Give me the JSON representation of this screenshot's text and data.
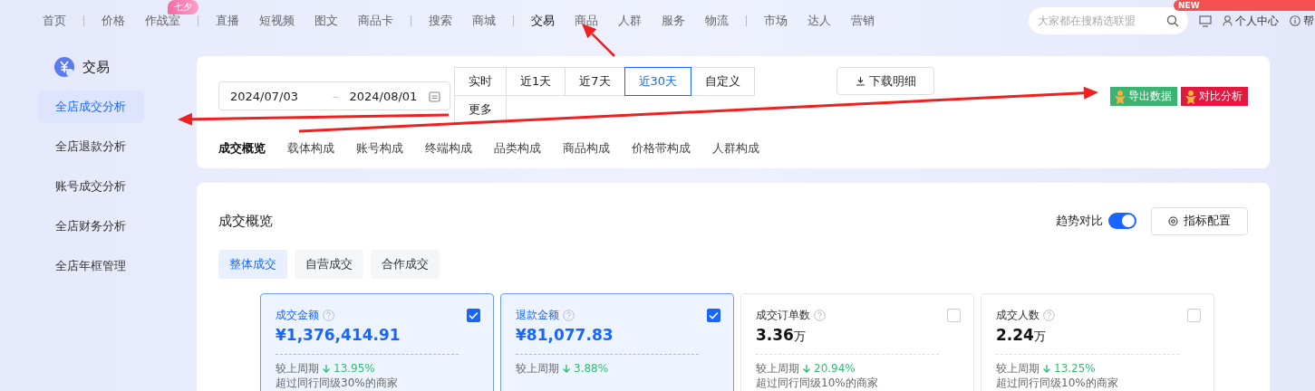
{
  "nav": {
    "groups": [
      {
        "items": [
          {
            "label": "首页",
            "selected": false
          }
        ]
      },
      {
        "items": [
          {
            "label": "价格",
            "selected": false
          },
          {
            "label": "作战室",
            "selected": false,
            "badge": "七夕"
          }
        ]
      },
      {
        "items": [
          {
            "label": "直播",
            "selected": false
          },
          {
            "label": "短视频",
            "selected": false
          },
          {
            "label": "图文",
            "selected": false
          },
          {
            "label": "商品卡",
            "selected": false
          }
        ]
      },
      {
        "items": [
          {
            "label": "搜索",
            "selected": false
          },
          {
            "label": "商城",
            "selected": false
          }
        ]
      },
      {
        "items": [
          {
            "label": "交易",
            "selected": true
          },
          {
            "label": "商品",
            "selected": false
          },
          {
            "label": "人群",
            "selected": false
          },
          {
            "label": "服务",
            "selected": false
          },
          {
            "label": "物流",
            "selected": false
          }
        ]
      },
      {
        "items": [
          {
            "label": "市场",
            "selected": false
          },
          {
            "label": "达人",
            "selected": false
          },
          {
            "label": "营销",
            "selected": false
          }
        ]
      }
    ],
    "search": {
      "placeholder": "大家都在搜精选联盟"
    },
    "new_badge": "NEW",
    "user_label": "个人中心",
    "help_label": "帮"
  },
  "sidebar": {
    "title": "交易",
    "items": [
      {
        "label": "全店成交分析",
        "selected": true
      },
      {
        "label": "全店退款分析",
        "selected": false
      },
      {
        "label": "账号成交分析",
        "selected": false
      },
      {
        "label": "全店财务分析",
        "selected": false
      },
      {
        "label": "全店年框管理",
        "selected": false
      }
    ]
  },
  "filters": {
    "date_start": "2024/07/03",
    "date_separator": "–",
    "date_end": "2024/08/01",
    "ranges": [
      {
        "label": "实时",
        "selected": false
      },
      {
        "label": "近1天",
        "selected": false
      },
      {
        "label": "近7天",
        "selected": false
      },
      {
        "label": "近30天",
        "selected": true
      },
      {
        "label": "自定义",
        "selected": false
      },
      {
        "label": "更多",
        "selected": false
      }
    ],
    "download": "下载明细",
    "export": "导出数据",
    "compare": "对比分析",
    "tabs": [
      {
        "label": "成交概览",
        "selected": true
      },
      {
        "label": "载体构成",
        "selected": false
      },
      {
        "label": "账号构成",
        "selected": false
      },
      {
        "label": "终端构成",
        "selected": false
      },
      {
        "label": "品类构成",
        "selected": false
      },
      {
        "label": "商品构成",
        "selected": false
      },
      {
        "label": "价格带构成",
        "selected": false
      },
      {
        "label": "人群构成",
        "selected": false
      }
    ]
  },
  "overview": {
    "title": "成交概览",
    "trend_label": "趋势对比",
    "trend_on": true,
    "config_button": "指标配置",
    "scopes": [
      {
        "label": "整体成交",
        "selected": true
      },
      {
        "label": "自营成交",
        "selected": false
      },
      {
        "label": "合作成交",
        "selected": false
      }
    ],
    "metrics": [
      {
        "title": "成交金额",
        "value": "¥1,376,414.91",
        "selected": true,
        "compare_label": "较上周期",
        "change": "13.95%",
        "benchmark": "超过同行同级30%的商家"
      },
      {
        "title": "退款金额",
        "value": "¥81,077.83",
        "selected": true,
        "compare_label": "较上周期",
        "change": "3.88%"
      },
      {
        "title": "成交订单数",
        "value": "3.36",
        "unit": "万",
        "selected": false,
        "compare_label": "较上周期",
        "change": "20.94%",
        "benchmark": "超过同行同级10%的商家"
      },
      {
        "title": "成交人数",
        "value": "2.24",
        "unit": "万",
        "selected": false,
        "compare_label": "较上周期",
        "change": "13.25%",
        "benchmark": "超过同行同级10%的商家"
      }
    ]
  }
}
